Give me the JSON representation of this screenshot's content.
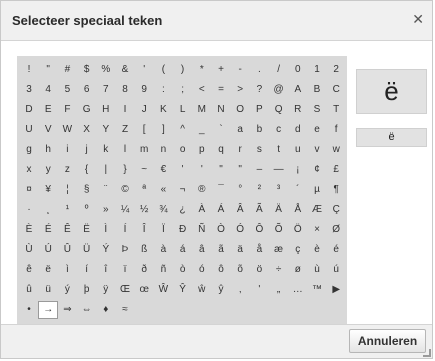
{
  "dialog": {
    "title": "Selecteer speciaal teken",
    "close_glyph": "✕",
    "cancel_label": "Annuleren"
  },
  "preview": {
    "large": "ë",
    "small": "ë"
  },
  "selected": {
    "row": 12,
    "col": 1
  },
  "characters": [
    [
      "!",
      "\"",
      "#",
      "$",
      "%",
      "&",
      "'",
      "(",
      ")",
      "*",
      "+",
      "-",
      ".",
      "/",
      "0",
      "1",
      "2"
    ],
    [
      "3",
      "4",
      "5",
      "6",
      "7",
      "8",
      "9",
      ":",
      ";",
      "<",
      "=",
      ">",
      "?",
      "@",
      "A",
      "B",
      "C"
    ],
    [
      "D",
      "E",
      "F",
      "G",
      "H",
      "I",
      "J",
      "K",
      "L",
      "M",
      "N",
      "O",
      "P",
      "Q",
      "R",
      "S",
      "T"
    ],
    [
      "U",
      "V",
      "W",
      "X",
      "Y",
      "Z",
      "[",
      "]",
      "^",
      "_",
      "`",
      "a",
      "b",
      "c",
      "d",
      "e",
      "f"
    ],
    [
      "g",
      "h",
      "i",
      "j",
      "k",
      "l",
      "m",
      "n",
      "o",
      "p",
      "q",
      "r",
      "s",
      "t",
      "u",
      "v",
      "w"
    ],
    [
      "x",
      "y",
      "z",
      "{",
      "|",
      "}",
      "~",
      "€",
      "'",
      "'",
      "\"",
      "\"",
      "–",
      "—",
      "¡",
      "¢",
      "£"
    ],
    [
      "¤",
      "¥",
      "¦",
      "§",
      "¨",
      "©",
      "ª",
      "«",
      "¬",
      "®",
      "¯",
      "°",
      "²",
      "³",
      "´",
      "µ",
      "¶"
    ],
    [
      "·",
      "¸",
      "¹",
      "º",
      "»",
      "¼",
      "½",
      "¾",
      "¿",
      "À",
      "Á",
      "Â",
      "Ã",
      "Ä",
      "Å",
      "Æ",
      "Ç"
    ],
    [
      "È",
      "É",
      "Ê",
      "Ë",
      "Ì",
      "Í",
      "Î",
      "Ï",
      "Ð",
      "Ñ",
      "Ò",
      "Ó",
      "Ô",
      "Õ",
      "Ö",
      "×",
      "Ø"
    ],
    [
      "Ù",
      "Ú",
      "Û",
      "Ü",
      "Ý",
      "Þ",
      "ß",
      "à",
      "á",
      "â",
      "ã",
      "ä",
      "å",
      "æ",
      "ç",
      "è",
      "é"
    ],
    [
      "ê",
      "ë",
      "ì",
      "í",
      "î",
      "ï",
      "ð",
      "ñ",
      "ò",
      "ó",
      "ô",
      "õ",
      "ö",
      "÷",
      "ø",
      "ù",
      "ú"
    ],
    [
      "û",
      "ü",
      "ý",
      "þ",
      "ÿ",
      "Œ",
      "œ",
      "Ŵ",
      "Ŷ",
      "ŵ",
      "ŷ",
      "‚",
      "'",
      "„",
      "…",
      "™",
      "▶"
    ],
    [
      "•",
      "→",
      "⇒",
      "⇔",
      "♦",
      "≈",
      "",
      "",
      "",
      "",
      "",
      "",
      "",
      "",
      "",
      "",
      ""
    ]
  ]
}
